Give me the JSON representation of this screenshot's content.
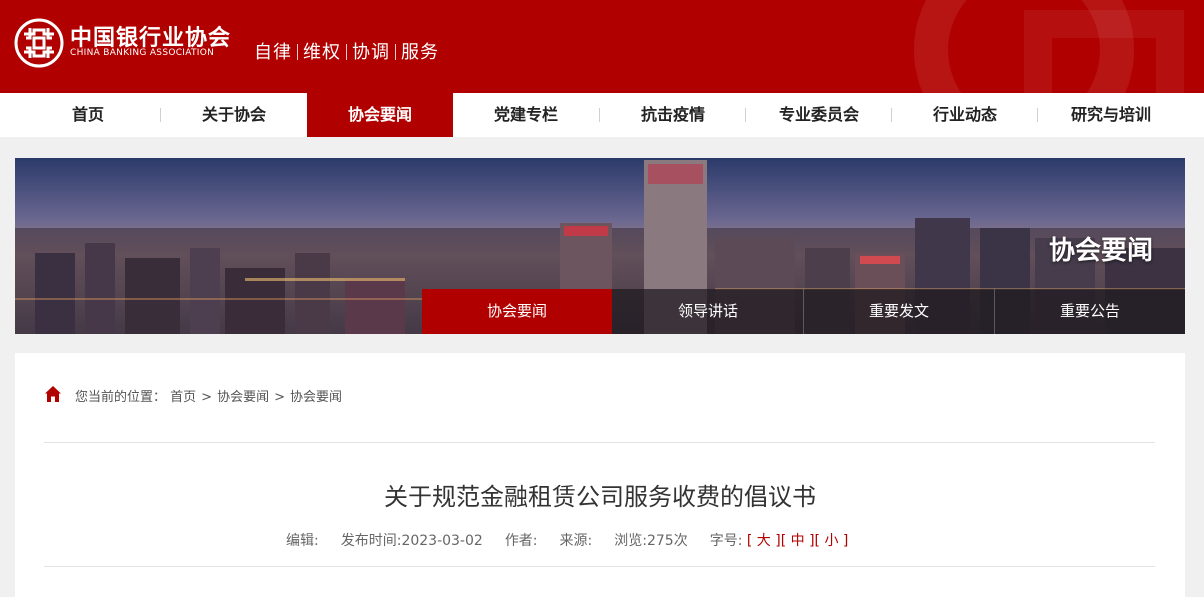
{
  "header": {
    "org_name_cn": "中国银行业协会",
    "org_name_en": "CHINA BANKING ASSOCIATION",
    "slogan": [
      "自律",
      "维权",
      "协调",
      "服务"
    ]
  },
  "nav": {
    "items": [
      "首页",
      "关于协会",
      "协会要闻",
      "党建专栏",
      "抗击疫情",
      "专业委员会",
      "行业动态",
      "研究与培训"
    ],
    "active_index": 2
  },
  "banner": {
    "title": "协会要闻",
    "subnav": [
      "协会要闻",
      "领导讲话",
      "重要发文",
      "重要公告"
    ],
    "active_index": 0
  },
  "breadcrumb": {
    "prefix": "您当前的位置：",
    "items": [
      "首页",
      "协会要闻",
      "协会要闻"
    ],
    "separator": ">"
  },
  "article": {
    "title": "关于规范金融租赁公司服务收费的倡议书",
    "meta": {
      "editor_label": "编辑:",
      "date_label": "发布时间:",
      "date": "2023-03-02",
      "author_label": "作者:",
      "source_label": "来源:",
      "views_label": "浏览:",
      "views": "275次",
      "font_size_label": "字号:",
      "font_size_options": [
        "[ 大 ]",
        "[ 中 ]",
        "[ 小 ]"
      ]
    }
  },
  "colors": {
    "brand_red": "#b10000",
    "page_bg": "#f0f0f0"
  }
}
